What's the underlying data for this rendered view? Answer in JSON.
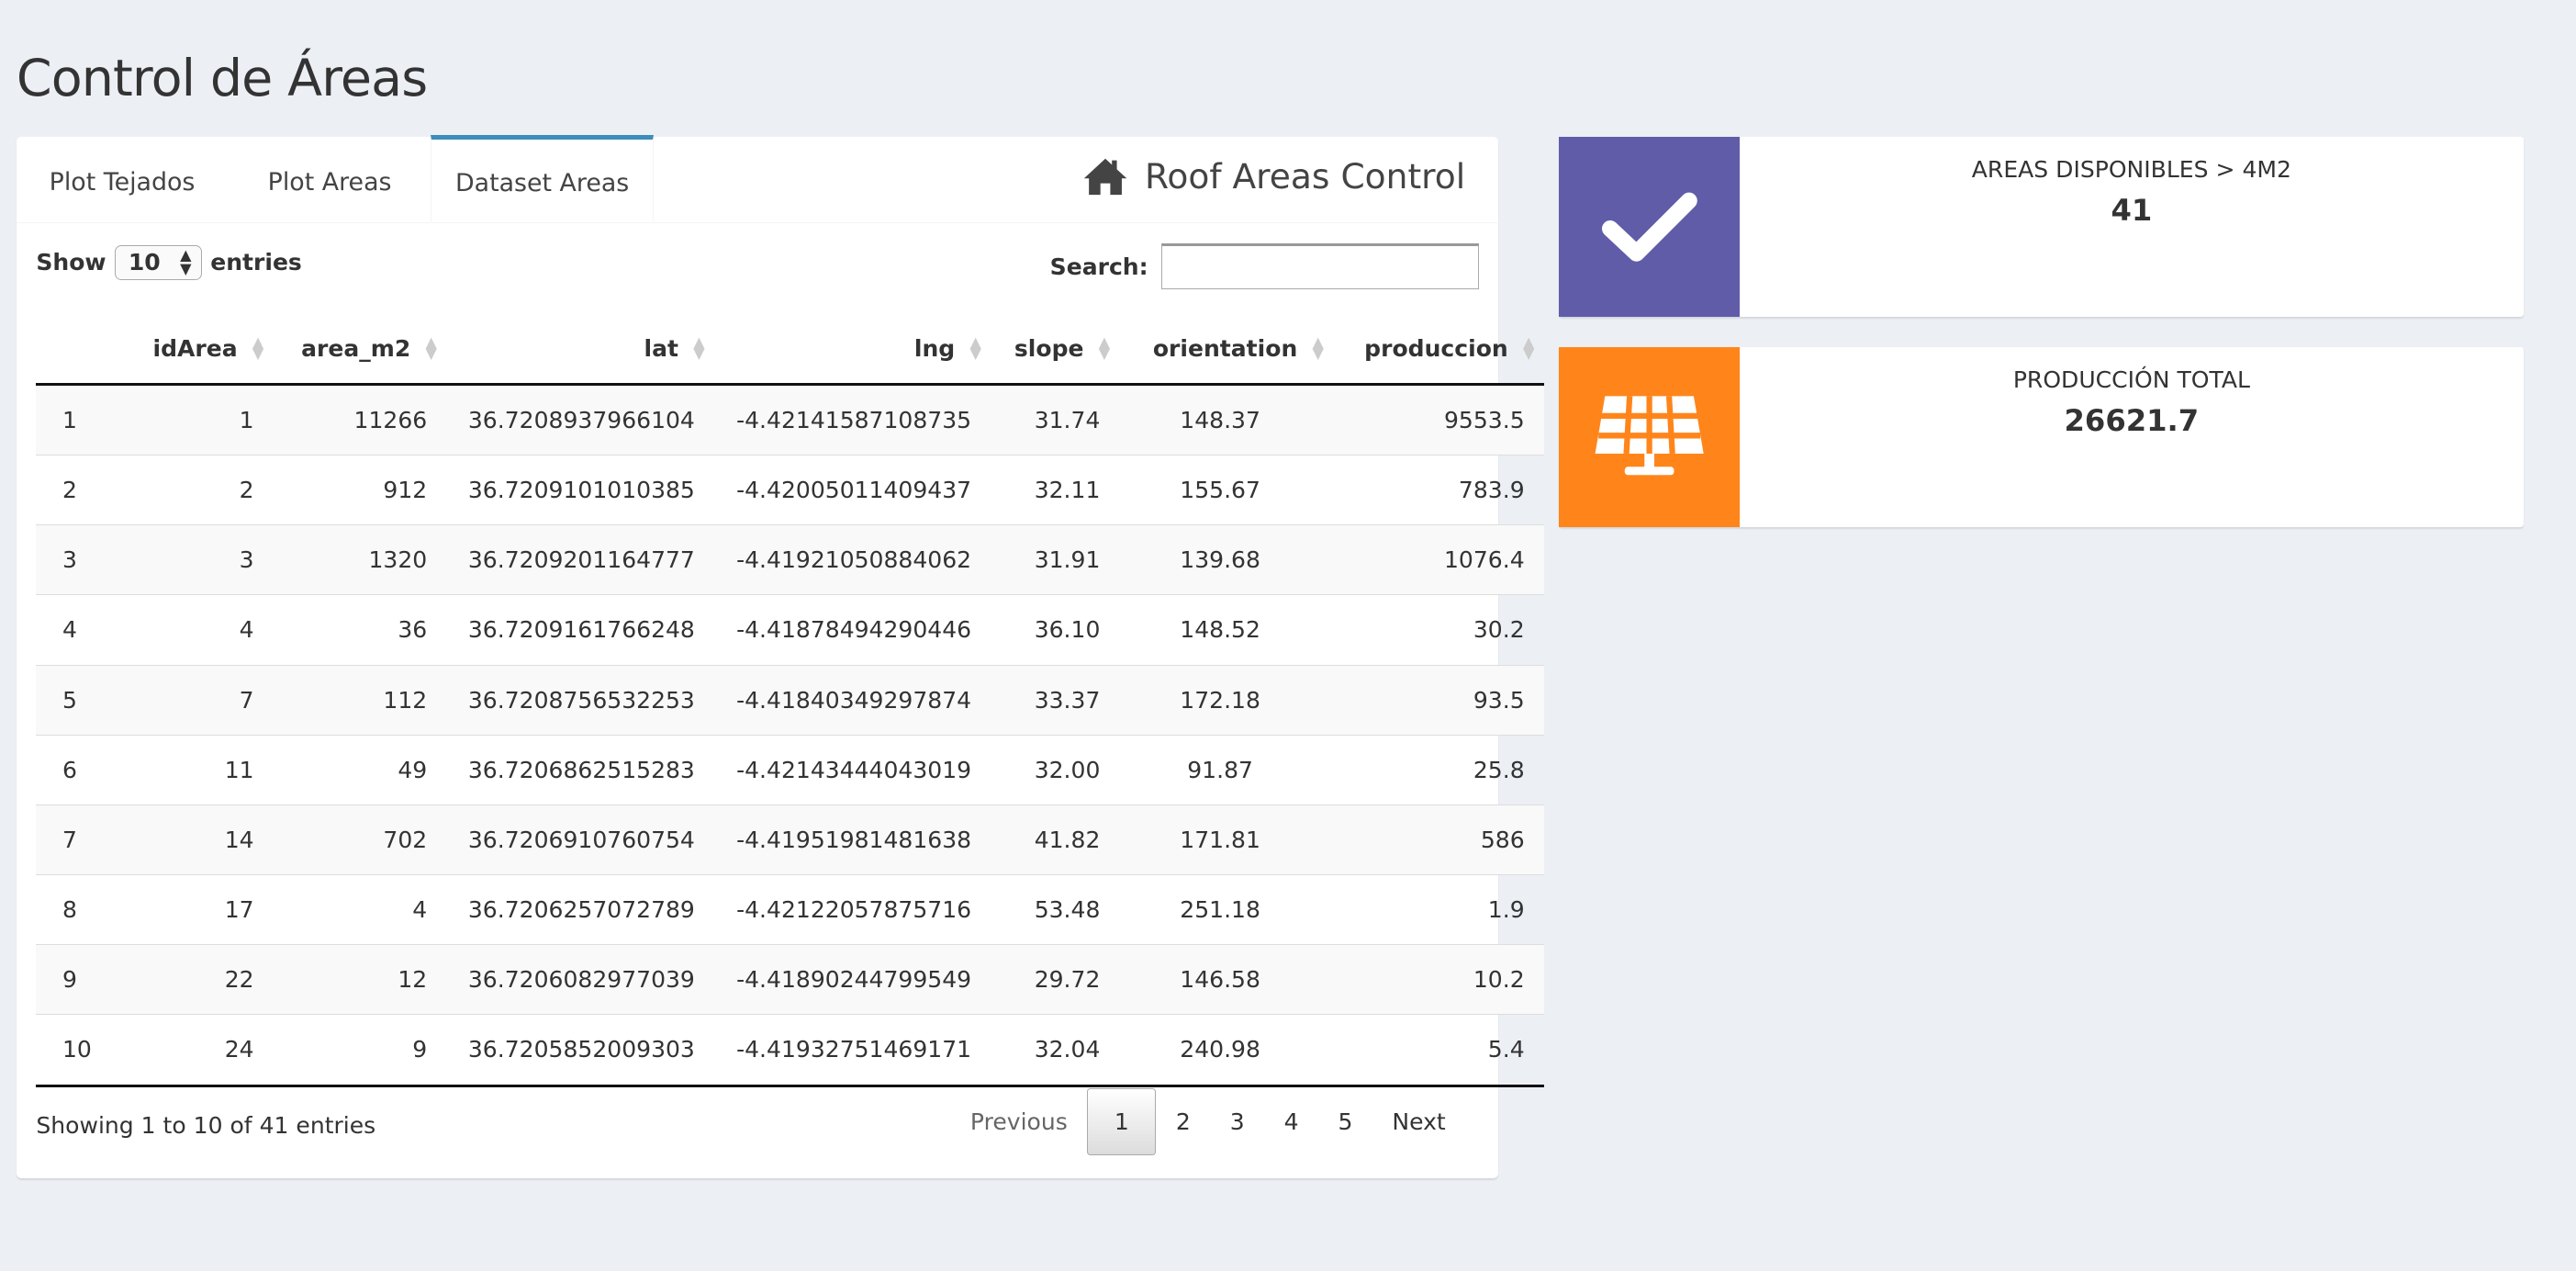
{
  "page": {
    "title": "Control de Áreas"
  },
  "tabs": [
    {
      "label": "Plot Tejados"
    },
    {
      "label": "Plot Areas"
    },
    {
      "label": "Dataset Areas"
    }
  ],
  "box": {
    "title": "Roof Areas Control",
    "icon": "home-icon"
  },
  "controls": {
    "show": "Show",
    "length_value": "10",
    "entries": "entries",
    "search_label": "Search:",
    "search_value": ""
  },
  "table": {
    "columns": [
      "",
      "idArea",
      "area_m2",
      "lat",
      "lng",
      "slope",
      "orientation",
      "produccion"
    ],
    "rows": [
      [
        "1",
        "1",
        "11266",
        "36.7208937966104",
        "-4.42141587108735",
        "31.74",
        "148.37",
        "9553.5"
      ],
      [
        "2",
        "2",
        "912",
        "36.7209101010385",
        "-4.42005011409437",
        "32.11",
        "155.67",
        "783.9"
      ],
      [
        "3",
        "3",
        "1320",
        "36.7209201164777",
        "-4.41921050884062",
        "31.91",
        "139.68",
        "1076.4"
      ],
      [
        "4",
        "4",
        "36",
        "36.7209161766248",
        "-4.41878494290446",
        "36.10",
        "148.52",
        "30.2"
      ],
      [
        "5",
        "7",
        "112",
        "36.7208756532253",
        "-4.41840349297874",
        "33.37",
        "172.18",
        "93.5"
      ],
      [
        "6",
        "11",
        "49",
        "36.7206862515283",
        "-4.42143444043019",
        "32.00",
        "91.87",
        "25.8"
      ],
      [
        "7",
        "14",
        "702",
        "36.7206910760754",
        "-4.41951981481638",
        "41.82",
        "171.81",
        "586"
      ],
      [
        "8",
        "17",
        "4",
        "36.7206257072789",
        "-4.42122057875716",
        "53.48",
        "251.18",
        "1.9"
      ],
      [
        "9",
        "22",
        "12",
        "36.7206082977039",
        "-4.41890244799549",
        "29.72",
        "146.58",
        "10.2"
      ],
      [
        "10",
        "24",
        "9",
        "36.7205852009303",
        "-4.41932751469171",
        "32.04",
        "240.98",
        "5.4"
      ]
    ]
  },
  "footer": {
    "info": "Showing 1 to 10 of 41 entries",
    "previous": "Previous",
    "pages": [
      "1",
      "2",
      "3",
      "4",
      "5"
    ],
    "next": "Next",
    "current_page": 1
  },
  "infoboxes": [
    {
      "label": "AREAS DISPONIBLES > 4M2",
      "value": "41",
      "icon": "checkmark-icon",
      "color": "#605ca8"
    },
    {
      "label": "PRODUCCIÓN TOTAL",
      "value": "26621.7",
      "icon": "solar-panel-icon",
      "color": "#ff851b"
    }
  ]
}
